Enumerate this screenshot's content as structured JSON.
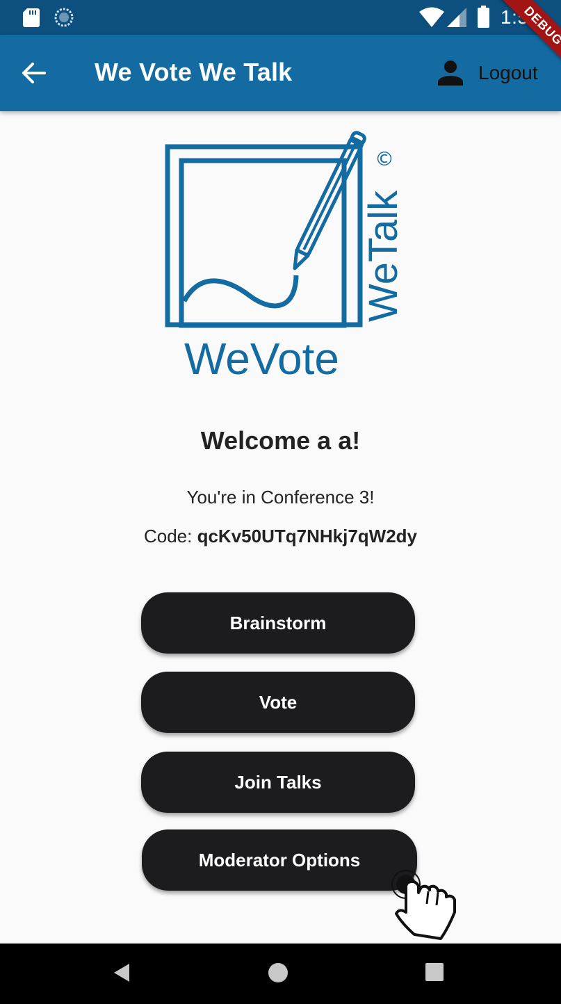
{
  "status_bar": {
    "time": "1:52",
    "icons": [
      "sd-card-icon",
      "sync-icon",
      "wifi-icon",
      "signal-icon",
      "battery-icon"
    ]
  },
  "debug_banner": "DEBUG",
  "app_bar": {
    "title": "We Vote We Talk",
    "back_icon": "arrow-back-icon",
    "logout_icon": "person-icon",
    "logout_label": "Logout"
  },
  "logo": {
    "primary_text": "WeVote",
    "secondary_text": "WeTalk",
    "mark": "©",
    "colors": {
      "brand": "#136ba2"
    }
  },
  "welcome": {
    "greeting": "Welcome a a!",
    "conference": "You're in Conference 3!",
    "code_label": "Code:",
    "code_value": "qcKv50UTq7NHkj7qW2dy"
  },
  "actions": {
    "brainstorm": "Brainstorm",
    "vote": "Vote",
    "join_talks": "Join Talks",
    "moderator_options": "Moderator Options"
  },
  "nav_bar": {
    "icons": [
      "nav-back-icon",
      "nav-home-icon",
      "nav-recents-icon"
    ]
  },
  "colors": {
    "status_bar": "#0d4f7f",
    "app_bar": "#136ba2",
    "button": "#1c1b1d",
    "background": "#fafafa",
    "ribbon": "#a31515"
  }
}
